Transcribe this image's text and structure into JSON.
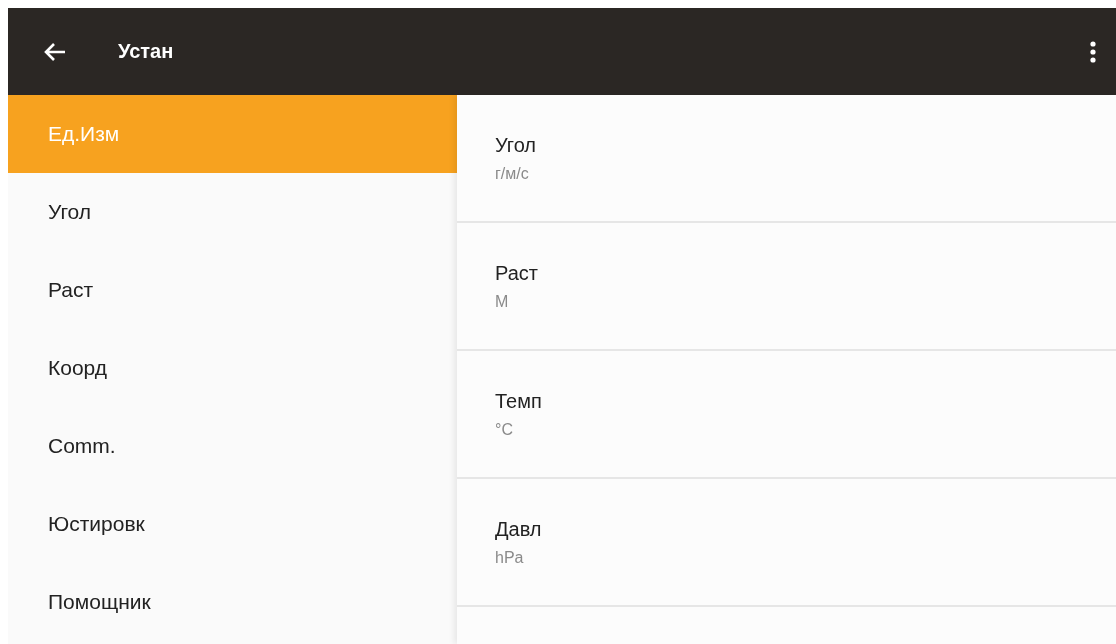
{
  "app_bar": {
    "title": "Устан"
  },
  "sidebar": {
    "items": [
      {
        "label": "Ед.Изм",
        "selected": true
      },
      {
        "label": "Угол",
        "selected": false
      },
      {
        "label": "Раст",
        "selected": false
      },
      {
        "label": "Коорд",
        "selected": false
      },
      {
        "label": "Comm.",
        "selected": false
      },
      {
        "label": "Юстировк",
        "selected": false
      },
      {
        "label": "Помощник",
        "selected": false
      }
    ]
  },
  "settings": [
    {
      "title": "Угол",
      "value": "г/м/с"
    },
    {
      "title": "Раст",
      "value": "М"
    },
    {
      "title": "Темп",
      "value": "°C"
    },
    {
      "title": "Давл",
      "value": "hPa"
    }
  ]
}
